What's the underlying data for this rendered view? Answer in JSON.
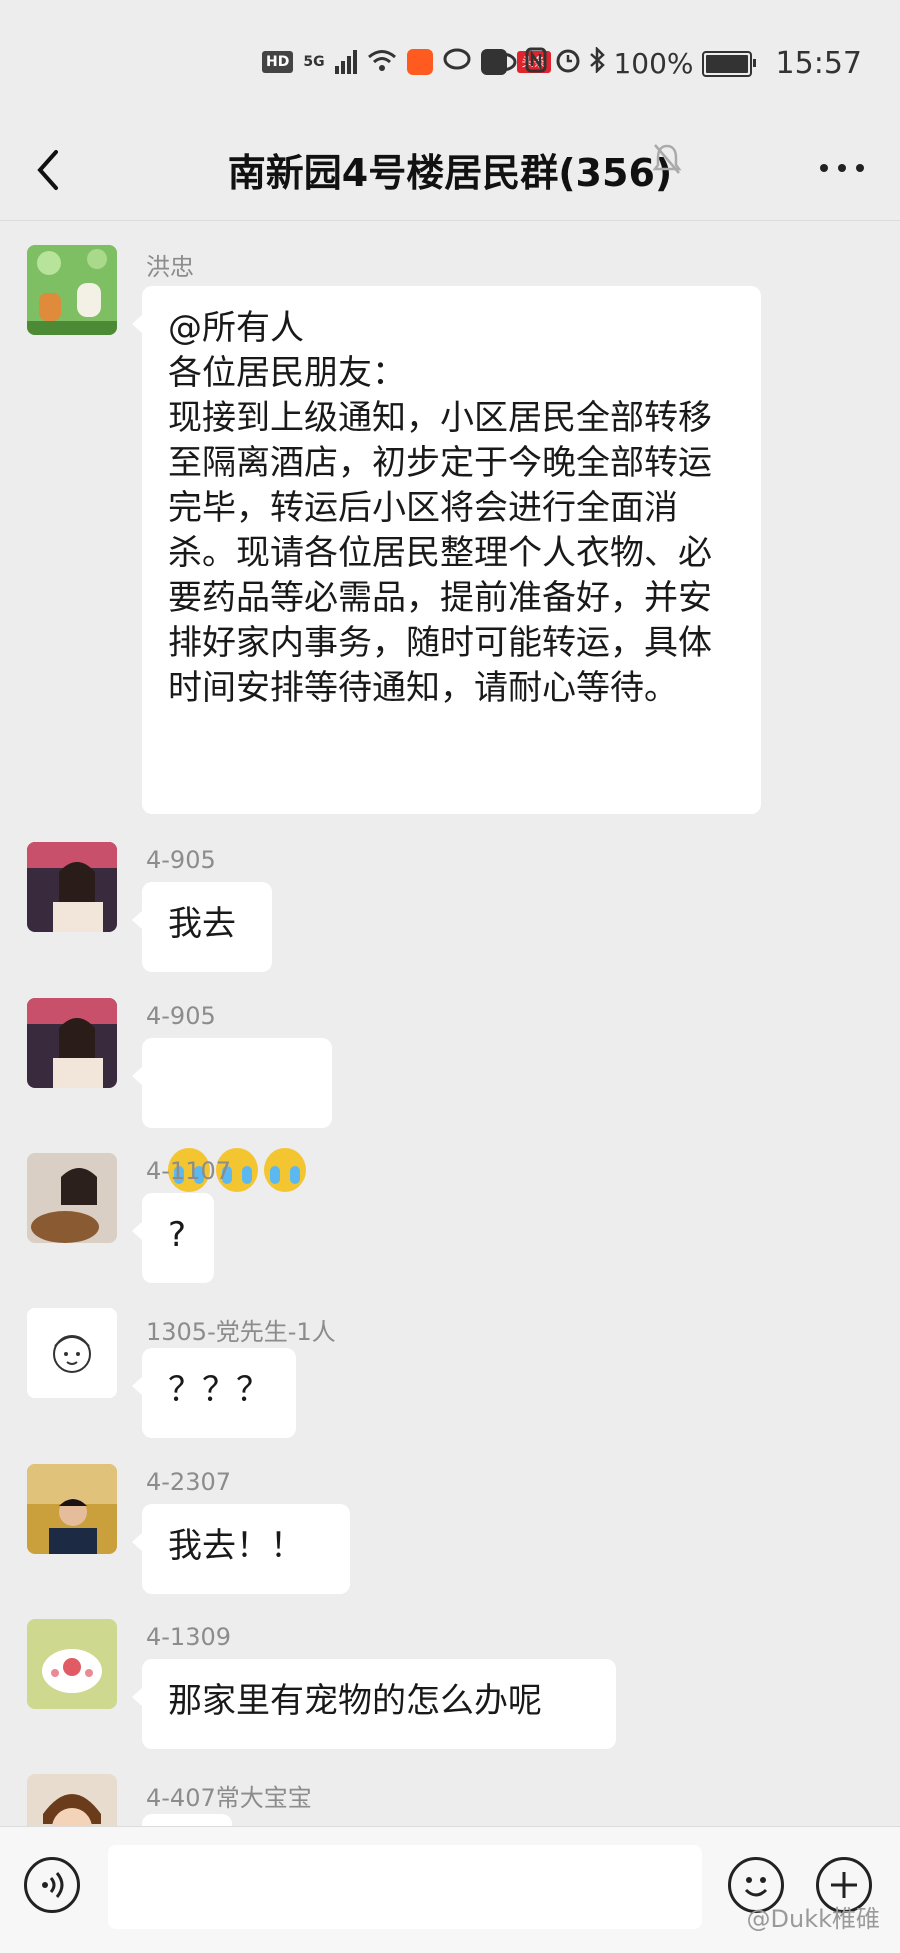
{
  "status_bar": {
    "network": "HD",
    "signal": "5G",
    "headline_badge": "头条",
    "battery": "100%",
    "time": "15:57"
  },
  "nav": {
    "title": "南新园4号楼居民群(356)"
  },
  "messages": [
    {
      "sender": "洪忠",
      "text": "@所有人\n各位居民朋友：\n现接到上级通知，小区居民全部转移至隔离酒店，初步定于今晚全部转运完毕，转运后小区将会进行全面消杀。现请各位居民整理个人衣物、必要药品等必需品，提前准备好，并安排好家内事务，随时可能转运，具体时间安排等待通知，请耐心等待。"
    },
    {
      "sender": "4-905",
      "text": "我去"
    },
    {
      "sender": "4-905",
      "text": ""
    },
    {
      "sender": "4-1107",
      "text": "?"
    },
    {
      "sender": "1305-党先生-1人",
      "text": "？？？"
    },
    {
      "sender": "4-2307",
      "text": "我去！！"
    },
    {
      "sender": "4-1309",
      "text": "那家里有宠物的怎么办呢"
    },
    {
      "sender": "4-407常大宝宝",
      "text": ""
    }
  ],
  "input_bar": {
    "watermark": "@Dukk椎碓"
  }
}
